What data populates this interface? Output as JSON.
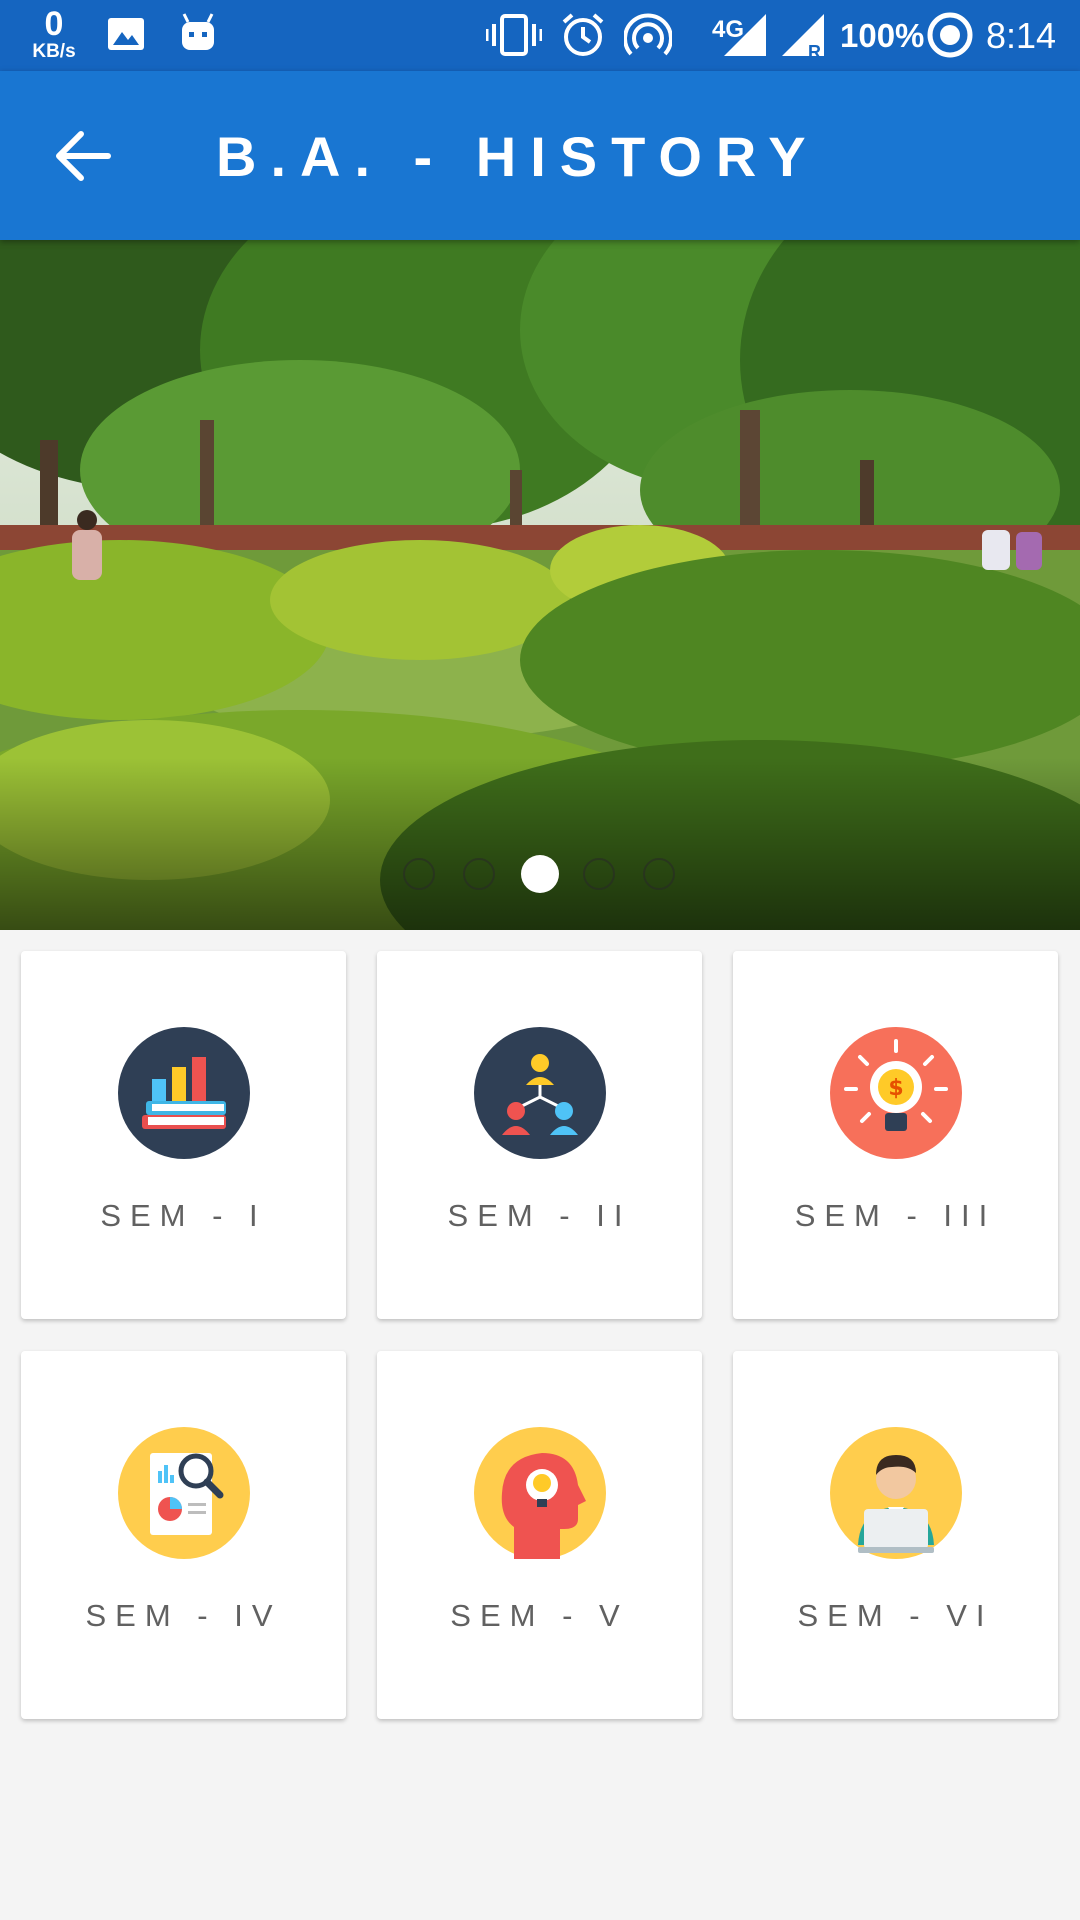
{
  "status_bar": {
    "net_speed_value": "0",
    "net_speed_unit": "KB/s",
    "network_type": "4G",
    "roaming_indicator": "R",
    "battery": "100%",
    "time": "8:14",
    "icons": [
      "image-icon",
      "android-debug-icon",
      "vibrate-icon",
      "alarm-icon",
      "hotspot-icon",
      "signal-icon",
      "signal-roaming-icon",
      "battery-saver-icon"
    ]
  },
  "app_bar": {
    "title": "B.A. - HISTORY",
    "back_icon": "arrow-left-icon",
    "color": "#1976d2"
  },
  "banner": {
    "description": "campus garden photo carousel",
    "slide_count": 5,
    "active_slide": 3
  },
  "semesters": [
    {
      "label": "SEM - I",
      "icon": "books-chart-icon"
    },
    {
      "label": "SEM - II",
      "icon": "team-hierarchy-icon"
    },
    {
      "label": "SEM - III",
      "icon": "lightbulb-dollar-icon"
    },
    {
      "label": "SEM - IV",
      "icon": "report-magnifier-icon"
    },
    {
      "label": "SEM - V",
      "icon": "head-idea-icon"
    },
    {
      "label": "SEM - VI",
      "icon": "person-laptop-icon"
    }
  ]
}
